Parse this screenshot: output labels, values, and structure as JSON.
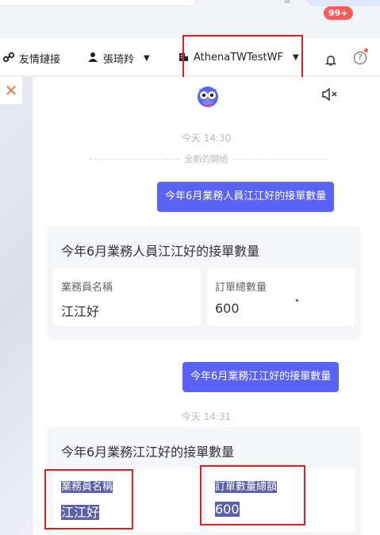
{
  "header": {
    "links_label": "友情鏈接",
    "user_name": "張琦羚",
    "tenant_name": "AthenaTWTestWF",
    "notification_count": "99+"
  },
  "chat": {
    "messages": [
      {
        "type": "timestamp",
        "text": "今天 14:30"
      },
      {
        "type": "divider",
        "text": "全新的開始"
      },
      {
        "type": "user",
        "text": "今年6月業務人員江江好的接單數量"
      },
      {
        "type": "card",
        "title": "今年6月業務人員江江好的接單數量",
        "fields": [
          {
            "label": "業務員名稱",
            "value": "江江好"
          },
          {
            "label": "訂單總數量",
            "value": "600"
          }
        ]
      },
      {
        "type": "user",
        "text": "今年6月業務江江好的接單數量"
      },
      {
        "type": "timestamp",
        "text": "今天 14:31"
      },
      {
        "type": "card",
        "title": "今年6月業務江江好的接單數量",
        "fields": [
          {
            "label": "業務員名稱",
            "value": "江江好"
          },
          {
            "label": "訂單數量總額",
            "value": "600"
          }
        ]
      }
    ]
  },
  "colors": {
    "accent": "#5a63f5",
    "highlight_box": "#e21d1d",
    "badge": "#ff5a5a",
    "selection": "#5b5fa6"
  }
}
